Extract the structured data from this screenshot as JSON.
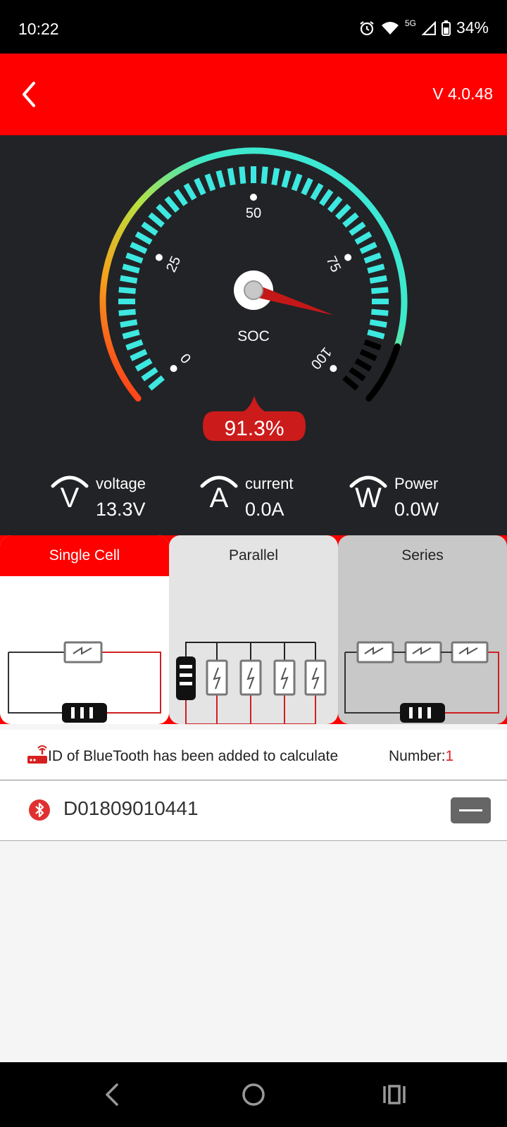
{
  "status": {
    "time": "10:22",
    "network": "5G",
    "battery": "34%"
  },
  "header": {
    "version": "V 4.0.48"
  },
  "gauge": {
    "label": "SOC",
    "value_text": "91.3%",
    "value": 91.3,
    "ticks": [
      "0",
      "25",
      "50",
      "75",
      "100"
    ],
    "colors": {
      "low": "#ff2a1a",
      "mid": "#f5c21a",
      "high": "#3de8e0",
      "tick": "#3de8e0",
      "empty": "#000000",
      "needle": "#c41818",
      "badge": "#cc1b1b"
    }
  },
  "readouts": [
    {
      "icon_letter": "V",
      "label": "voltage",
      "value": "13.3V"
    },
    {
      "icon_letter": "A",
      "label": "current",
      "value": "0.0A"
    },
    {
      "icon_letter": "W",
      "label": "Power",
      "value": "0.0W"
    }
  ],
  "modes": [
    {
      "label": "Single Cell",
      "selected": true
    },
    {
      "label": "Parallel",
      "selected": false
    },
    {
      "label": "Series",
      "selected": false
    }
  ],
  "info": {
    "text": "ID of BlueTooth has been added to calculate",
    "number_label": "Number:",
    "number_value": "1"
  },
  "devices": [
    {
      "id": "D01809010441"
    }
  ]
}
